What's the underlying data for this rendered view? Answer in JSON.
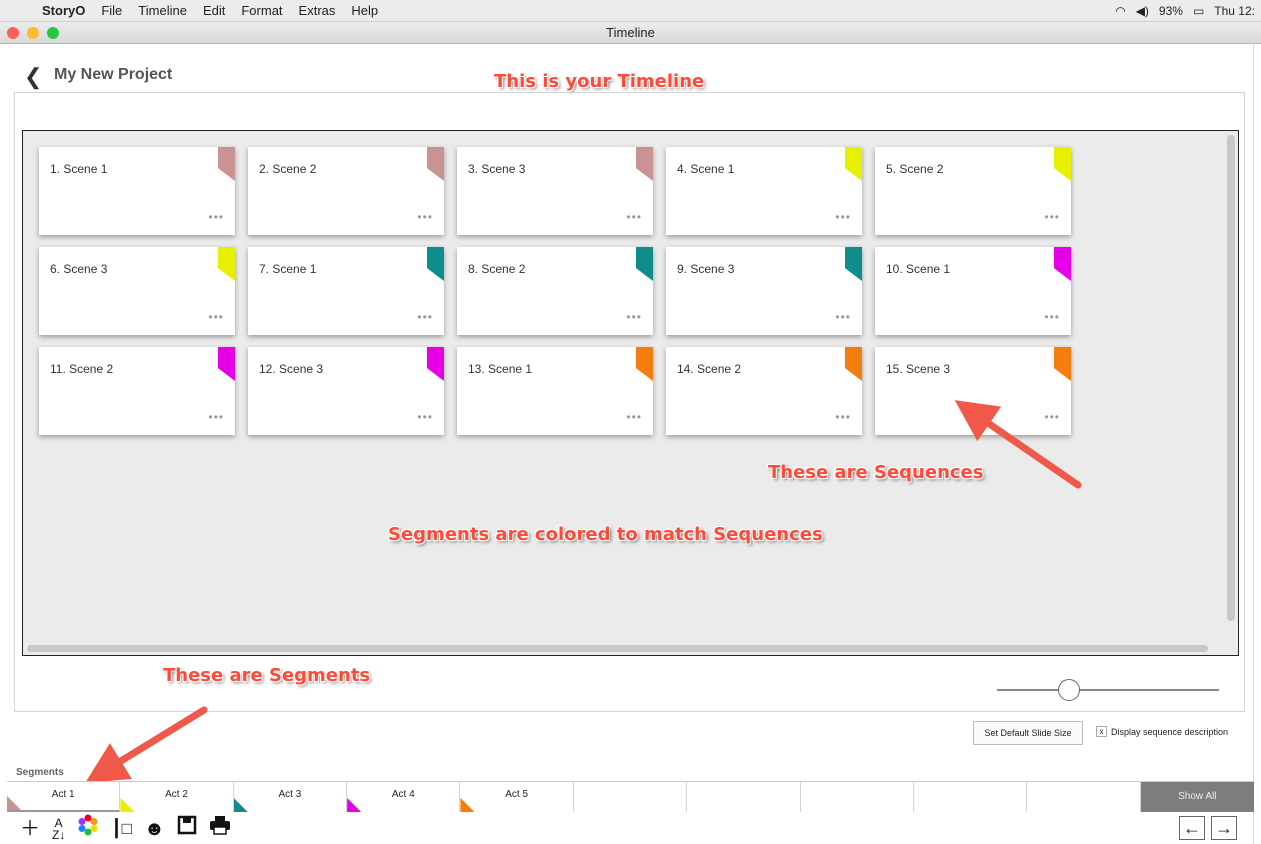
{
  "menubar": {
    "apple": "",
    "app": "StoryO",
    "items": [
      "File",
      "Timeline",
      "Edit",
      "Format",
      "Extras",
      "Help"
    ],
    "battery": "93%",
    "clock": "Thu 12:"
  },
  "window": {
    "title": "Timeline",
    "project_title": "My New Project"
  },
  "annotations": {
    "timeline": "This is your Timeline",
    "sequences": "These are Sequences",
    "segments_colored": "Segments are colored to match Sequences",
    "segments": "These are Segments"
  },
  "cards": [
    {
      "title": "1. Scene 1",
      "color": "#c99393"
    },
    {
      "title": "2. Scene 2",
      "color": "#c99393"
    },
    {
      "title": "3. Scene 3",
      "color": "#c99393"
    },
    {
      "title": "4. Scene 1",
      "color": "#e6f000"
    },
    {
      "title": "5. Scene 2",
      "color": "#e6f000"
    },
    {
      "title": "6. Scene 3",
      "color": "#e6f000"
    },
    {
      "title": "7. Scene 1",
      "color": "#0f8c8c"
    },
    {
      "title": "8. Scene 2",
      "color": "#0f8c8c"
    },
    {
      "title": "9. Scene 3",
      "color": "#0f8c8c"
    },
    {
      "title": "10. Scene 1",
      "color": "#e600e6"
    },
    {
      "title": "11. Scene 2",
      "color": "#e600e6"
    },
    {
      "title": "12. Scene 3",
      "color": "#e600e6"
    },
    {
      "title": "13. Scene 1",
      "color": "#f57d0f"
    },
    {
      "title": "14. Scene 2",
      "color": "#f57d0f"
    },
    {
      "title": "15. Scene 3",
      "color": "#f57d0f"
    }
  ],
  "card_more": "•••",
  "controls": {
    "set_default": "Set Default Slide Size",
    "display_desc": "Display sequence description",
    "checkbox_mark": "x"
  },
  "segments": {
    "label": "Segments",
    "items": [
      {
        "label": "Act 1",
        "color": "#c99393"
      },
      {
        "label": "Act 2",
        "color": "#e6f000"
      },
      {
        "label": "Act 3",
        "color": "#0f8c8c"
      },
      {
        "label": "Act 4",
        "color": "#e600e6"
      },
      {
        "label": "Act 5",
        "color": "#f57d0f"
      },
      {
        "label": "",
        "color": ""
      },
      {
        "label": "",
        "color": ""
      },
      {
        "label": "",
        "color": ""
      },
      {
        "label": "",
        "color": ""
      },
      {
        "label": "",
        "color": ""
      }
    ],
    "show_all": "Show All"
  },
  "toolbar": {
    "icons": [
      "plus-icon",
      "sort-az-icon",
      "color-wheel-icon",
      "hierarchy-icon",
      "person-icon",
      "save-icon",
      "print-icon"
    ]
  },
  "nav": {
    "prev": "←",
    "next": "→"
  }
}
